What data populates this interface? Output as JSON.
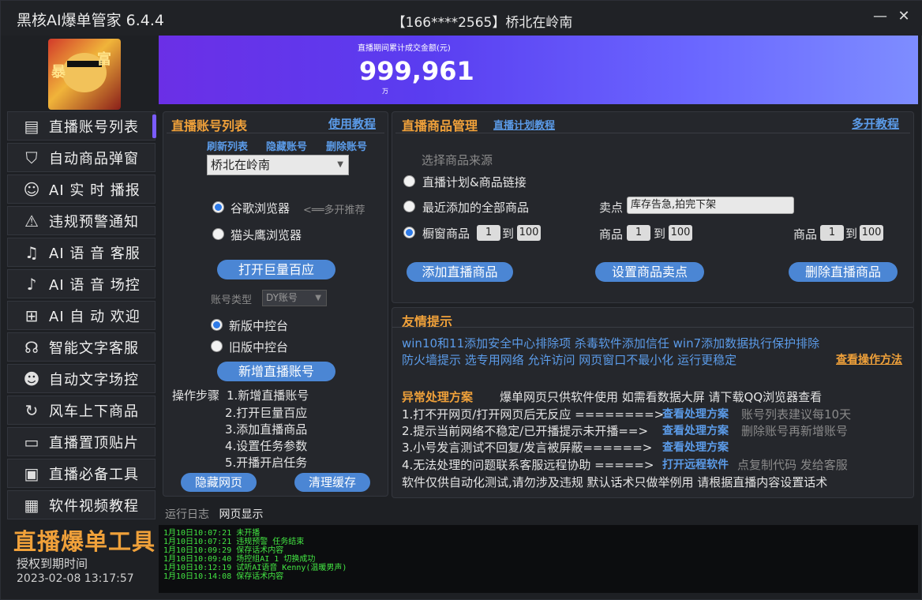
{
  "app": {
    "title": "黑核AI爆单管家 6.4.4",
    "account_title": "【166****2565】桥北在岭南",
    "minimize": "—",
    "close": "✕"
  },
  "sidebar": {
    "items": [
      {
        "label": "直播账号列表",
        "icon": "id-card-icon"
      },
      {
        "label": "自动商品弹窗",
        "icon": "shopping-bag-icon"
      },
      {
        "label": "AI 实 时 播报",
        "icon": "agent-icon"
      },
      {
        "label": "违规预警通知",
        "icon": "alarm-icon"
      },
      {
        "label": "AI 语 音 客服",
        "icon": "voice-service-icon"
      },
      {
        "label": "AI 语 音 场控",
        "icon": "microphone-icon"
      },
      {
        "label": "AI 自 动 欢迎",
        "icon": "hi-icon"
      },
      {
        "label": "智能文字客服",
        "icon": "headset-icon"
      },
      {
        "label": "自动文字场控",
        "icon": "users-icon"
      },
      {
        "label": "风车上下商品",
        "icon": "refresh-icon"
      },
      {
        "label": "直播置顶贴片",
        "icon": "message-icon"
      },
      {
        "label": "直播必备工具",
        "icon": "camera-icon"
      },
      {
        "label": "软件视频教程",
        "icon": "video-icon"
      }
    ],
    "brand": "直播爆单工具",
    "auth_label": "授权到期时间",
    "auth_date": "2023-02-08 13:17:57"
  },
  "banner": {
    "label": "直播期间累计成交金额(元)",
    "value": "999,961",
    "unit": "万"
  },
  "account_panel": {
    "title": "直播账号列表",
    "tutorial": "使用教程",
    "refresh": "刷新列表",
    "hide": "隐藏账号",
    "delete": "删除账号",
    "selected_account": "桥北在岭南",
    "browser_chrome": "谷歌浏览器",
    "browser_hint": "<══多开推荐",
    "browser_owl": "猫头鹰浏览器",
    "open_btn": "打开巨量百应",
    "type_label": "账号类型",
    "type_value": "DY账号",
    "console_new": "新版中控台",
    "console_old": "旧版中控台",
    "add_btn": "新增直播账号",
    "steps_title": "操作步骤",
    "steps": [
      "1.新增直播账号",
      "2.打开巨量百应",
      "3.添加直播商品",
      "4.设置任务参数",
      "5.开播开启任务"
    ],
    "hide_page": "隐藏网页",
    "clear_cache": "清理缓存"
  },
  "goods_panel": {
    "title": "直播商品管理",
    "plan_tutorial": "直播计划教程",
    "multi_tutorial": "多开教程",
    "source_label": "选择商品来源",
    "opt_plan": "直播计划&商品链接",
    "opt_recent": "最近添加的全部商品",
    "opt_window": "橱窗商品",
    "range_to": "到",
    "range_from": "1",
    "range_end": "100",
    "selling_label": "卖点",
    "selling_value": "库存告急,拍完下架",
    "goods_label": "商品",
    "add_btn": "添加直播商品",
    "set_btn": "设置商品卖点",
    "del_btn": "删除直播商品"
  },
  "tips_panel": {
    "title": "友情提示",
    "line1": "win10和11添加安全中心排除项  杀毒软件添加信任  win7添加数据执行保护排除",
    "line2": "防火墙提示 选专用网络 允许访问  网页窗口不最小化  运行更稳定",
    "view_method": "查看操作方法",
    "abn_title": "异常处理方案",
    "abn_desc": "爆单网页只供软件使用  如需看数据大屏  请下载QQ浏览器查看",
    "row1": "1.打不开网页/打开网页后无反应 ========>",
    "row1_link": "查看处理方案",
    "row1_note": "账号列表建议每10天",
    "row2": "2.提示当前网络不稳定/已开播提示未开播==>",
    "row2_link": "查看处理方案",
    "row2_note": "删除账号再新增账号",
    "row3": "3.小号发言测试不回复/发言被屏蔽======>",
    "row3_link": "查看处理方案",
    "row4": "4.无法处理的问题联系客服远程协助 =====>",
    "row4_link": "打开远程软件",
    "row4_note": "点复制代码  发给客服",
    "footer": "软件仅供自动化测试,请勿涉及违规  默认话术只做举例用  请根据直播内容设置话术"
  },
  "log": {
    "tab_run": "运行日志",
    "tab_web": "网页显示",
    "lines": [
      "1月10日10:07:21 未开播",
      "1月10日10:07:21 违规预警 任务结束",
      "1月10日10:09:29 保存话术内容",
      "1月10日10:09:40 场控组AI 1 切换成功",
      "1月10日10:12:19 试听AI语音 Kenny(温暖男声)",
      "1月10日10:14:08 保存话术内容"
    ]
  },
  "colors": {
    "accent_orange": "#f0a13a",
    "link_blue": "#5b9be8",
    "button_blue": "#4b86d4",
    "log_green": "#43e643",
    "banner_purple": "#6b2fe6"
  }
}
